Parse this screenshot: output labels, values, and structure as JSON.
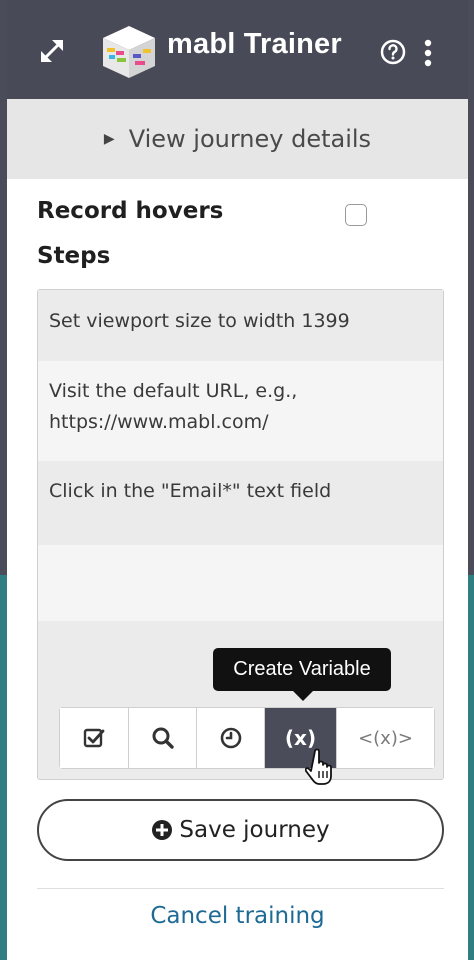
{
  "header": {
    "app_title": "mabl Trainer",
    "icons": [
      "expand-icon",
      "mabl-logo-icon",
      "help-icon",
      "more-icon"
    ]
  },
  "details": {
    "label": "View journey details"
  },
  "record": {
    "label": "Record hovers",
    "checked": false
  },
  "steps": {
    "title": "Steps",
    "items": [
      {
        "text": "Set viewport size to width 1399"
      },
      {
        "text": "Visit the default URL, e.g., https://www.mabl.com/"
      },
      {
        "text": "Click in the \"Email*\" text field"
      }
    ]
  },
  "toolbar": {
    "tooltip": "Create Variable",
    "buttons": [
      {
        "icon": "checkbox-icon"
      },
      {
        "icon": "search-icon"
      },
      {
        "icon": "clock-icon"
      },
      {
        "label": "(x)",
        "active": true
      },
      {
        "label": "<(x)>"
      }
    ]
  },
  "actions": {
    "save_label": "Save journey",
    "cancel_label": "Cancel training"
  },
  "colors": {
    "header_bg": "#484a58",
    "active_button": "#4a4c59",
    "link": "#1f6a95",
    "teal_background": "#2f7f82"
  }
}
